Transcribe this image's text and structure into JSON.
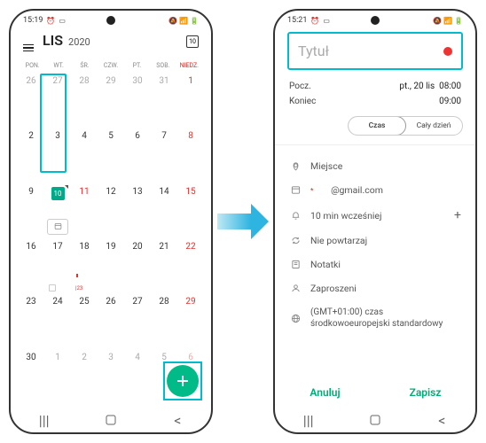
{
  "left": {
    "status_time": "15:19",
    "month": "LIS",
    "year": "2020",
    "today_num": "10",
    "weekdays": [
      "PON.",
      "WT.",
      "ŚR.",
      "CZW.",
      "PT.",
      "SOB.",
      "NIEDZ."
    ],
    "weeks": [
      [
        {
          "n": "26",
          "cls": "other"
        },
        {
          "n": "27",
          "cls": "other"
        },
        {
          "n": "28",
          "cls": "other"
        },
        {
          "n": "29",
          "cls": "other"
        },
        {
          "n": "30",
          "cls": "other"
        },
        {
          "n": "31",
          "cls": "other"
        },
        {
          "n": "1",
          "cls": "sun"
        }
      ],
      [
        {
          "n": "2"
        },
        {
          "n": "3"
        },
        {
          "n": "4"
        },
        {
          "n": "5"
        },
        {
          "n": "6"
        },
        {
          "n": "7"
        },
        {
          "n": "8",
          "cls": "sun"
        }
      ],
      [
        {
          "n": "9"
        },
        {
          "n": "10",
          "today": true
        },
        {
          "n": "11",
          "cls": "sun"
        },
        {
          "n": "12"
        },
        {
          "n": "13"
        },
        {
          "n": "14"
        },
        {
          "n": "15",
          "cls": "sun"
        }
      ],
      [
        {
          "n": "16"
        },
        {
          "n": "17"
        },
        {
          "n": "18"
        },
        {
          "n": "19"
        },
        {
          "n": "20"
        },
        {
          "n": "21"
        },
        {
          "n": "22",
          "cls": "sun"
        }
      ],
      [
        {
          "n": "23"
        },
        {
          "n": "24"
        },
        {
          "n": "25"
        },
        {
          "n": "26"
        },
        {
          "n": "27"
        },
        {
          "n": "28"
        },
        {
          "n": "29",
          "cls": "sun"
        }
      ],
      [
        {
          "n": "30"
        },
        {
          "n": "1",
          "cls": "other"
        },
        {
          "n": "2",
          "cls": "other"
        },
        {
          "n": "3",
          "cls": "other"
        },
        {
          "n": "4",
          "cls": "other"
        },
        {
          "n": "5",
          "cls": "other"
        },
        {
          "n": "6",
          "cls": "other sun"
        }
      ]
    ],
    "item_count_18": "|23"
  },
  "right": {
    "status_time": "15:21",
    "title_placeholder": "Tytuł",
    "start_label": "Pocz.",
    "start_date": "pt., 20 lis",
    "start_time": "08:00",
    "end_label": "Koniec",
    "end_time": "09:00",
    "seg_time": "Czas",
    "seg_allday": "Cały dzień",
    "place": "Miejsce",
    "account_suffix": "@gmail.com",
    "reminder": "10 min wcześniej",
    "repeat": "Nie powtarzaj",
    "notes": "Notatki",
    "invitees": "Zaproszeni",
    "timezone_line1": "(GMT+01:00) czas",
    "timezone_line2": "środkowoeuropejski standardowy",
    "cancel": "Anuluj",
    "save": "Zapisz"
  }
}
